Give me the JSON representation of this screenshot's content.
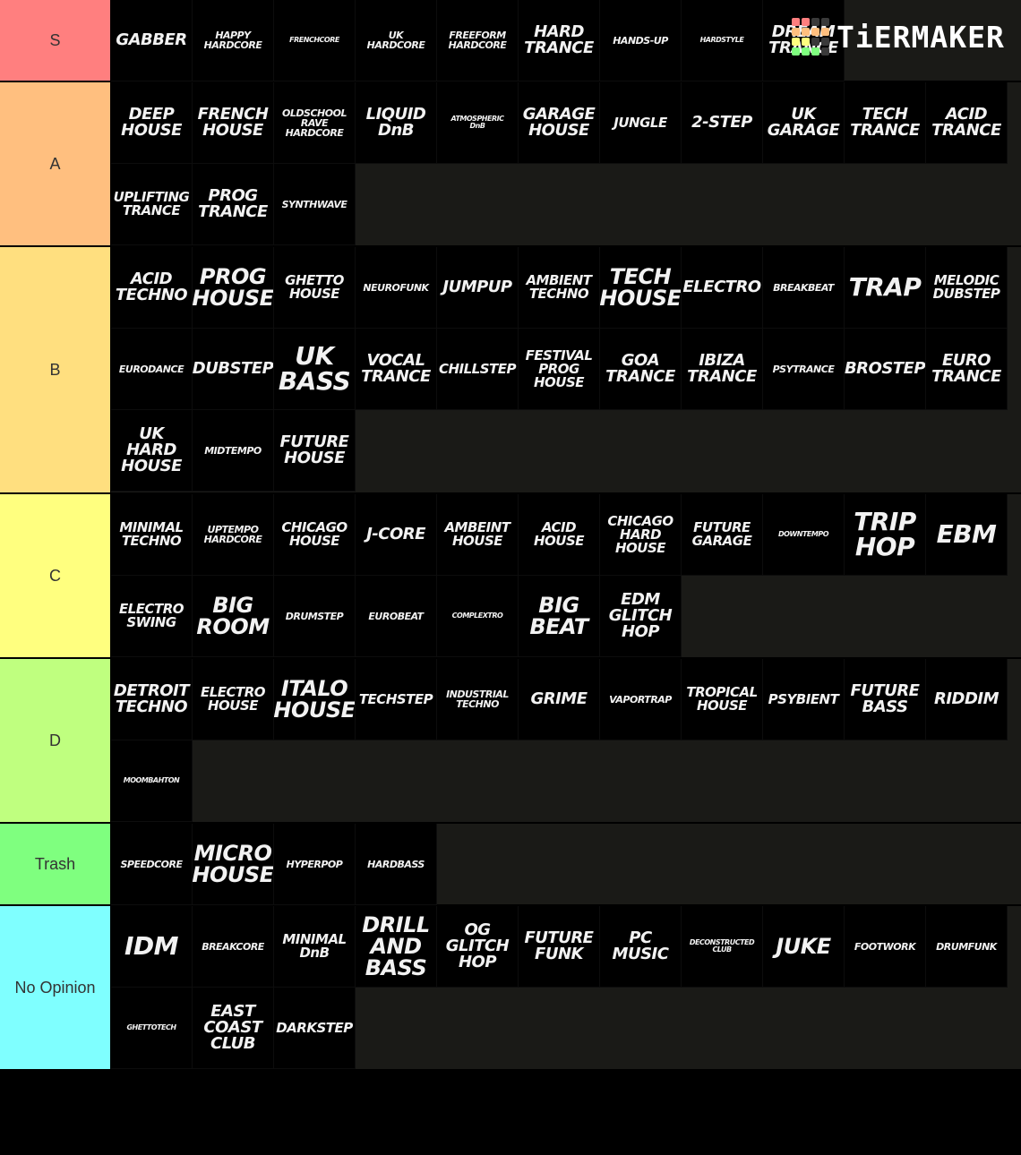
{
  "logo": {
    "text": "TiERMAKER",
    "grid_colors": [
      "#ff7f7f",
      "#ff7f7f",
      "#3a3a3a",
      "#3a3a3a",
      "#ffbf7f",
      "#ffbf7f",
      "#ffbf7f",
      "#ffbf7f",
      "#ffff7f",
      "#ffff7f",
      "#3a3a3a",
      "#3a3a3a",
      "#7fff7f",
      "#7fff7f",
      "#7fff7f",
      "#3a3a3a"
    ]
  },
  "tiers": [
    {
      "label": "S",
      "color": "#ff7f7f",
      "items": [
        {
          "text": "GABBER",
          "size": "l"
        },
        {
          "text": "HAPPY\nHARDCORE",
          "size": "s"
        },
        {
          "text": "FRENCHCORE",
          "size": "xs"
        },
        {
          "text": "UK\nHARDCORE",
          "size": "s"
        },
        {
          "text": "FREEFORM\nHARDCORE",
          "size": "s"
        },
        {
          "text": "HARD\nTRANCE",
          "size": "l"
        },
        {
          "text": "HANDS-UP",
          "size": "s"
        },
        {
          "text": "HARDSTYLE",
          "size": "xs"
        },
        {
          "text": "DREAM\nTRANCE",
          "size": "l"
        }
      ]
    },
    {
      "label": "A",
      "color": "#ffbf7f",
      "items": [
        {
          "text": "DEEP\nHOUSE",
          "size": "l"
        },
        {
          "text": "FRENCH\nHOUSE",
          "size": "l"
        },
        {
          "text": "OLDSCHOOL\nRAVE\nHARDCORE",
          "size": "s"
        },
        {
          "text": "LIQUID\nDnB",
          "size": "l"
        },
        {
          "text": "ATMOSPHERIC\nDnB",
          "size": "xs"
        },
        {
          "text": "GARAGE\nHOUSE",
          "size": "l"
        },
        {
          "text": "JUNGLE",
          "size": "m"
        },
        {
          "text": "2-STEP",
          "size": "l"
        },
        {
          "text": "UK\nGARAGE",
          "size": "l"
        },
        {
          "text": "TECH\nTRANCE",
          "size": "l"
        },
        {
          "text": "ACID\nTRANCE",
          "size": "l"
        },
        {
          "text": "UPLIFTING\nTRANCE",
          "size": "m"
        },
        {
          "text": "PROG\nTRANCE",
          "size": "l"
        },
        {
          "text": "SYNTHWAVE",
          "size": "s"
        }
      ]
    },
    {
      "label": "B",
      "color": "#ffdf7f",
      "items": [
        {
          "text": "ACID\nTECHNO",
          "size": "l"
        },
        {
          "text": "PROG\nHOUSE",
          "size": "xl"
        },
        {
          "text": "GHETTO\nHOUSE",
          "size": "m"
        },
        {
          "text": "NEUROFUNK",
          "size": "s"
        },
        {
          "text": "JUMPUP",
          "size": "l"
        },
        {
          "text": "AMBIENT\nTECHNO",
          "size": "m"
        },
        {
          "text": "TECH\nHOUSE",
          "size": "xl"
        },
        {
          "text": "ELECTRO",
          "size": "l"
        },
        {
          "text": "BREAKBEAT",
          "size": "s"
        },
        {
          "text": "TRAP",
          "size": "xxl"
        },
        {
          "text": "MELODIC\nDUBSTEP",
          "size": "m"
        },
        {
          "text": "EURODANCE",
          "size": "s"
        },
        {
          "text": "DUBSTEP",
          "size": "l"
        },
        {
          "text": "UK\nBASS",
          "size": "xxl"
        },
        {
          "text": "VOCAL\nTRANCE",
          "size": "l"
        },
        {
          "text": "CHILLSTEP",
          "size": "m"
        },
        {
          "text": "FESTIVAL\nPROG\nHOUSE",
          "size": "m"
        },
        {
          "text": "GOA\nTRANCE",
          "size": "l"
        },
        {
          "text": "IBIZA\nTRANCE",
          "size": "l"
        },
        {
          "text": "PSYTRANCE",
          "size": "s"
        },
        {
          "text": "BROSTEP",
          "size": "l"
        },
        {
          "text": "EURO\nTRANCE",
          "size": "l"
        },
        {
          "text": "UK\nHARD\nHOUSE",
          "size": "l"
        },
        {
          "text": "MIDTEMPO",
          "size": "s"
        },
        {
          "text": "FUTURE\nHOUSE",
          "size": "l"
        }
      ]
    },
    {
      "label": "C",
      "color": "#ffff7f",
      "items": [
        {
          "text": "MINIMAL\nTECHNO",
          "size": "m"
        },
        {
          "text": "UPTEMPO\nHARDCORE",
          "size": "s"
        },
        {
          "text": "CHICAGO\nHOUSE",
          "size": "m"
        },
        {
          "text": "J-CORE",
          "size": "l"
        },
        {
          "text": "AMBEINT\nHOUSE",
          "size": "m"
        },
        {
          "text": "ACID\nHOUSE",
          "size": "m"
        },
        {
          "text": "CHICAGO\nHARD\nHOUSE",
          "size": "m"
        },
        {
          "text": "FUTURE\nGARAGE",
          "size": "m"
        },
        {
          "text": "DOWNTEMPO",
          "size": "xs"
        },
        {
          "text": "TRIP\nHOP",
          "size": "xxl"
        },
        {
          "text": "EBM",
          "size": "xxl"
        },
        {
          "text": "ELECTRO\nSWING",
          "size": "m"
        },
        {
          "text": "BIG\nROOM",
          "size": "xl"
        },
        {
          "text": "DRUMSTEP",
          "size": "s"
        },
        {
          "text": "EUROBEAT",
          "size": "s"
        },
        {
          "text": "COMPLEXTRO",
          "size": "xs"
        },
        {
          "text": "BIG\nBEAT",
          "size": "xl"
        },
        {
          "text": "EDM\nGLITCH\nHOP",
          "size": "l"
        }
      ]
    },
    {
      "label": "D",
      "color": "#bfff7f",
      "items": [
        {
          "text": "DETROIT\nTECHNO",
          "size": "l"
        },
        {
          "text": "ELECTRO\nHOUSE",
          "size": "m"
        },
        {
          "text": "ITALO\nHOUSE",
          "size": "xl"
        },
        {
          "text": "TECHSTEP",
          "size": "m"
        },
        {
          "text": "INDUSTRIAL\nTECHNO",
          "size": "s"
        },
        {
          "text": "GRIME",
          "size": "l"
        },
        {
          "text": "VAPORTRAP",
          "size": "s"
        },
        {
          "text": "TROPICAL\nHOUSE",
          "size": "m"
        },
        {
          "text": "PSYBIENT",
          "size": "m"
        },
        {
          "text": "FUTURE\nBASS",
          "size": "l"
        },
        {
          "text": "RIDDIM",
          "size": "l"
        },
        {
          "text": "MOOMBAHTON",
          "size": "xs"
        }
      ]
    },
    {
      "label": "Trash",
      "color": "#7fff7f",
      "items": [
        {
          "text": "SPEEDCORE",
          "size": "s"
        },
        {
          "text": "MICRO\nHOUSE",
          "size": "xl"
        },
        {
          "text": "HYPERPOP",
          "size": "s"
        },
        {
          "text": "HARDBASS",
          "size": "s"
        }
      ]
    },
    {
      "label": "No Opinion",
      "color": "#7fffff",
      "items": [
        {
          "text": "IDM",
          "size": "xxl"
        },
        {
          "text": "BREAKCORE",
          "size": "s"
        },
        {
          "text": "MINIMAL\nDnB",
          "size": "m"
        },
        {
          "text": "DRILL\nAND\nBASS",
          "size": "xl"
        },
        {
          "text": "OG\nGLITCH\nHOP",
          "size": "l"
        },
        {
          "text": "FUTURE\nFUNK",
          "size": "l"
        },
        {
          "text": "PC\nMUSIC",
          "size": "l"
        },
        {
          "text": "DECONSTRUCTED\nCLUB",
          "size": "xs"
        },
        {
          "text": "JUKE",
          "size": "xl"
        },
        {
          "text": "FOOTWORK",
          "size": "s"
        },
        {
          "text": "DRUMFUNK",
          "size": "s"
        },
        {
          "text": "GHETTOTECH",
          "size": "xs"
        },
        {
          "text": "EAST\nCOAST\nCLUB",
          "size": "l"
        },
        {
          "text": "DARKSTEP",
          "size": "m"
        }
      ]
    }
  ]
}
